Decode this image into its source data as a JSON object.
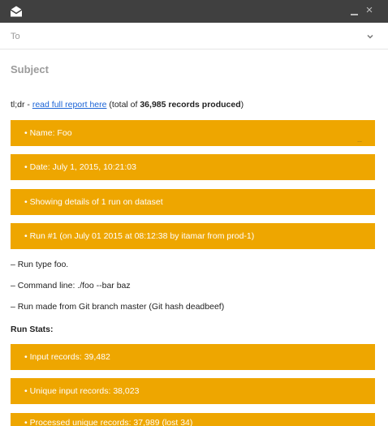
{
  "window": {
    "minimize_icon": "minimize-icon",
    "close_glyph": "×"
  },
  "to_field": {
    "label": "To"
  },
  "subject": {
    "placeholder": "Subject"
  },
  "summary": {
    "prefix": "tl;dr - ",
    "link_text": "read full report here",
    "middle": " (total of ",
    "count": "36,985 records produced",
    "suffix": ")"
  },
  "header_bars": [
    {
      "text": "• Name: Foo",
      "overflow": "..."
    },
    {
      "text": "• Date: July 1, 2015, 10:21:03"
    },
    {
      "text": "• Showing details of 1 run on dataset"
    },
    {
      "text": "• Run #1 (on July 01 2015 at 08:12:38 by itamar from prod-1)"
    }
  ],
  "run_lines": [
    "– Run type foo.",
    "– Command line: ./foo --bar baz",
    "– Run made from Git branch master (Git hash deadbeef)"
  ],
  "stats_heading": "Run Stats:",
  "stat_bars": [
    {
      "text": "• Input records: 39,482"
    },
    {
      "text": "• Unique input records: 38,023"
    },
    {
      "text": "• Processed unique records: 37,989 (lost 34)"
    }
  ],
  "colors": {
    "accent_bar": "#eea600",
    "titlebar": "#404040",
    "link": "#1a63d6"
  }
}
